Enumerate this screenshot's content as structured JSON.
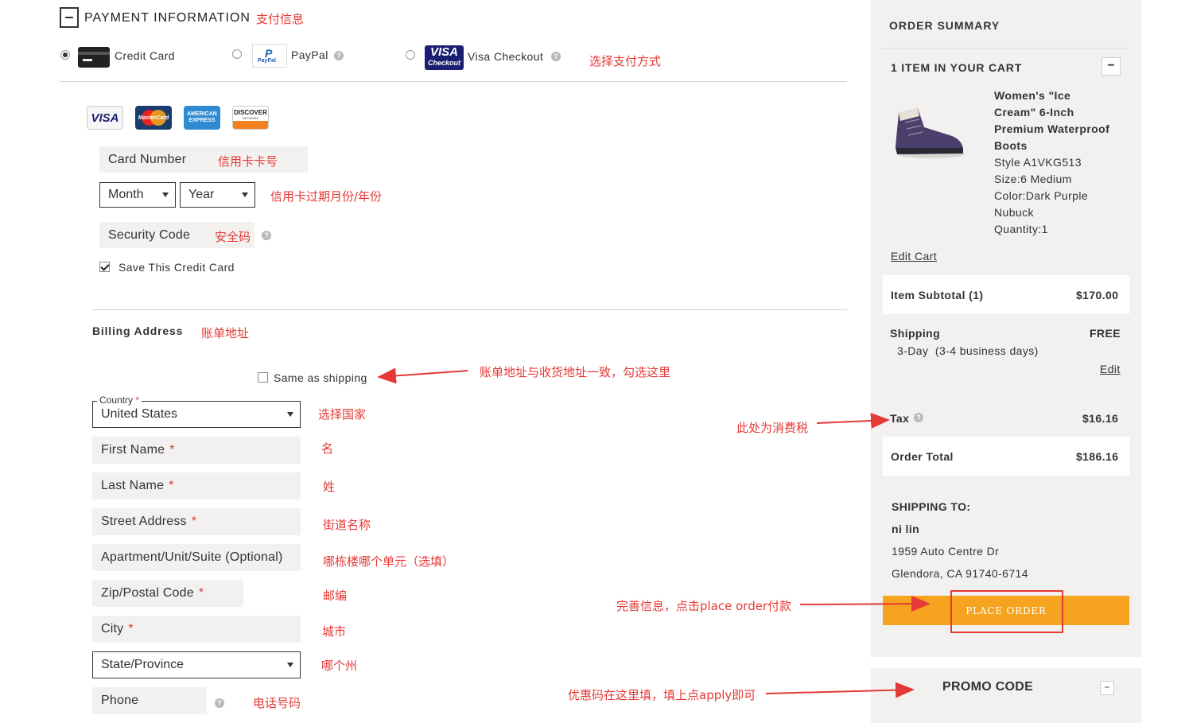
{
  "payment": {
    "section_title": "PAYMENT INFORMATION",
    "section_note": "支付信息",
    "methods": [
      {
        "label": "Credit Card",
        "selected": true
      },
      {
        "label": "PayPal",
        "selected": false
      },
      {
        "label": "Visa Checkout",
        "selected": false
      }
    ],
    "methods_note": "选择支付方式",
    "paypal_logo_text": "PayPal",
    "visa_checkout_logo_top": "VISA",
    "visa_checkout_logo_bottom": "Checkout",
    "card_logos": {
      "visa": "VISA",
      "mastercard": "MasterCard",
      "amex_top": "AMERICAN",
      "amex_bottom": "EXPRESS",
      "discover_top": "DISCOVER",
      "discover_bottom": "NETWORK"
    },
    "card_number_placeholder": "Card Number",
    "card_number_note": "信用卡卡号",
    "month_value": "Month",
    "year_value": "Year",
    "expiry_note": "信用卡过期月份/年份",
    "security_code_placeholder": "Security Code",
    "security_code_note": "安全码",
    "save_card_label": "Save This Credit Card",
    "save_card_checked": true
  },
  "billing": {
    "title": "Billing Address",
    "title_note": "账单地址",
    "same_as_shipping_label": "Same as shipping",
    "same_as_shipping_note": "账单地址与收货地址一致，勾选这里",
    "country_label": "Country",
    "country_value": "United States",
    "country_note": "选择国家",
    "fields": [
      {
        "label": "First Name",
        "required": "*",
        "note": "名"
      },
      {
        "label": "Last Name",
        "required": "*",
        "note": "姓"
      },
      {
        "label": "Street Address",
        "required": "*",
        "note": "街道名称"
      },
      {
        "label": "Apartment/Unit/Suite (Optional)",
        "required": "",
        "note": "哪栋楼哪个单元（选填）"
      },
      {
        "label": "Zip/Postal Code",
        "required": "*",
        "note": "邮编"
      },
      {
        "label": "City",
        "required": "*",
        "note": "城市"
      }
    ],
    "state_value": "State/Province",
    "state_note": "哪个州",
    "phone_placeholder": "Phone",
    "phone_note": "电话号码",
    "required_mark": "*"
  },
  "summary": {
    "title": "ORDER SUMMARY",
    "cart_count": "1 ITEM IN YOUR CART",
    "collapse_symbol": "−",
    "product": {
      "name_lines": [
        "Women's \"Ice",
        "Cream\" 6-Inch",
        "Premium Waterproof",
        "Boots"
      ],
      "style": "Style A1VKG513",
      "size": "Size:6 Medium",
      "color_line1": "Color:Dark Purple",
      "color_line2": "Nubuck",
      "quantity": "Quantity:1"
    },
    "edit_cart": "Edit Cart",
    "subtotal_label": "Item Subtotal (1)",
    "subtotal_value": "$170.00",
    "shipping_label": "Shipping",
    "shipping_value": "FREE",
    "shipping_method": "3-Day  (3-4 business days)",
    "shipping_edit": "Edit",
    "tax_label": "Tax",
    "tax_value": "$16.16",
    "tax_note": "此处为消费税",
    "total_label": "Order Total",
    "total_value": "$186.16",
    "ship_to_title": "SHIPPING TO:",
    "ship_name": "ni lin",
    "ship_street": "1959 Auto Centre Dr",
    "ship_city": "Glendora, CA 91740-6714",
    "place_order_label": "PLACE ORDER",
    "place_order_note": "完善信息，点击place order付款",
    "promo_title": "PROMO CODE",
    "promo_note": "优惠码在这里填，填上点apply即可"
  },
  "colors": {
    "accent": "#f6a31f",
    "annotation": "#e53935",
    "panel": "#f2f1ef"
  }
}
